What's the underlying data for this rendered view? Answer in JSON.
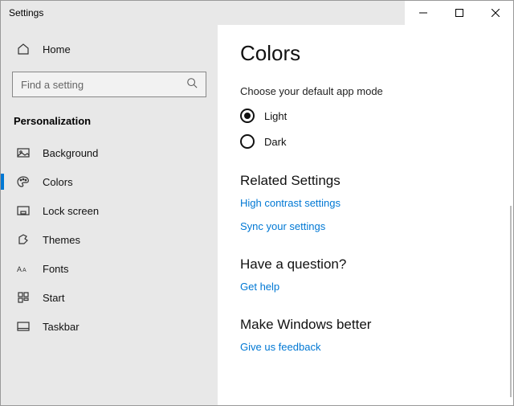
{
  "window": {
    "title": "Settings"
  },
  "sidebar": {
    "home": "Home",
    "search_placeholder": "Find a setting",
    "category": "Personalization",
    "items": [
      {
        "label": "Background"
      },
      {
        "label": "Colors"
      },
      {
        "label": "Lock screen"
      },
      {
        "label": "Themes"
      },
      {
        "label": "Fonts"
      },
      {
        "label": "Start"
      },
      {
        "label": "Taskbar"
      }
    ]
  },
  "main": {
    "title": "Colors",
    "mode_label": "Choose your default app mode",
    "mode_options": {
      "light": "Light",
      "dark": "Dark"
    },
    "sections": {
      "related": {
        "title": "Related Settings",
        "links": {
          "contrast": "High contrast settings",
          "sync": "Sync your settings"
        }
      },
      "question": {
        "title": "Have a question?",
        "links": {
          "help": "Get help"
        }
      },
      "feedback": {
        "title": "Make Windows better",
        "links": {
          "give": "Give us feedback"
        }
      }
    }
  }
}
